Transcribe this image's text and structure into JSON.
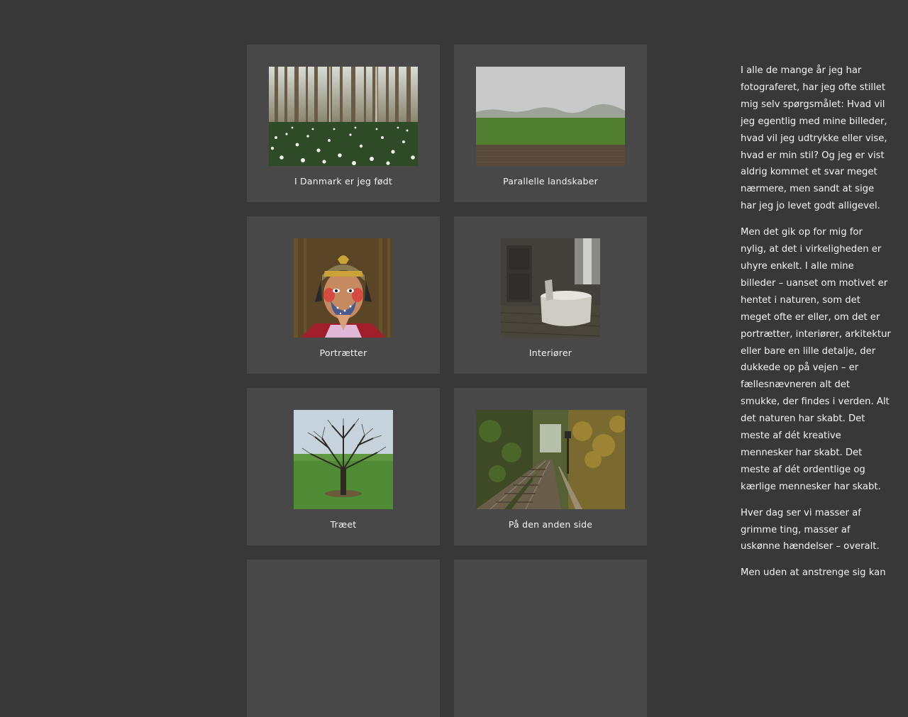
{
  "gallery": [
    {
      "title": "I Danmark er jeg født",
      "image": "forest-anemones-photo"
    },
    {
      "title": "Parallelle landskaber",
      "image": "misty-field-photo"
    },
    {
      "title": "Portrætter",
      "image": "painted-face-portrait-photo"
    },
    {
      "title": "Interiører",
      "image": "dark-room-table-photo"
    },
    {
      "title": "Træet",
      "image": "lone-oak-tree-photo"
    },
    {
      "title": "På den anden side",
      "image": "railway-forest-photo"
    },
    {
      "title": "",
      "image": ""
    },
    {
      "title": "",
      "image": ""
    }
  ],
  "article": {
    "paragraphs": [
      "I alle de mange år jeg har fotograferet, har jeg ofte stillet mig selv spørgsmålet: Hvad vil jeg egentlig med mine billeder, hvad vil jeg udtrykke eller vise, hvad er min stil? Og jeg er vist aldrig kommet et svar meget nærmere, men sandt at sige har jeg jo levet godt alligevel.",
      "Men det gik op for mig for nylig, at det i virkeligheden er uhyre enkelt. I alle mine billeder – uanset om motivet er hentet i naturen, som det meget ofte er eller, om det er portrætter, interiører, arkitektur eller bare en lille detalje, der dukkede op på vejen – er fællesnævneren alt det smukke, der findes i verden. Alt det naturen har skabt. Det meste af dét kreative mennesker har skabt. Det meste af dét ordentlige og kærlige mennesker har skabt.",
      "Hver dag ser vi masser af grimme ting, masser af uskønne hændelser – overalt.",
      "Men uden at anstrenge sig kan"
    ]
  },
  "colors": {
    "background": "#383838",
    "card": "#484848",
    "text": "#f2f2f2"
  }
}
